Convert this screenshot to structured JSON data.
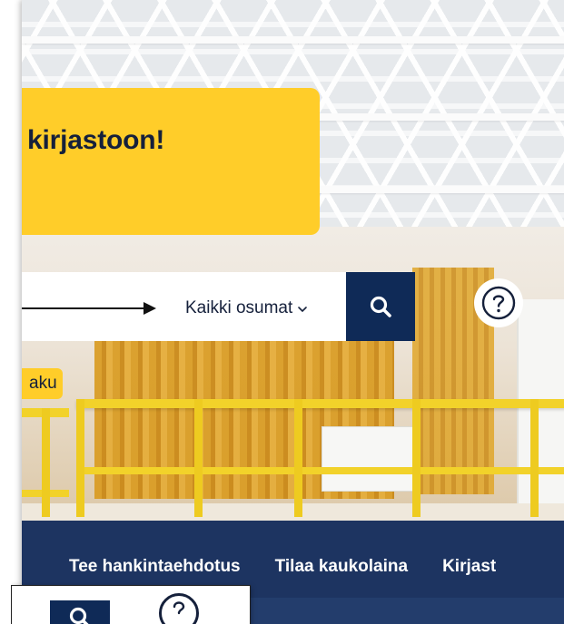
{
  "hero": {
    "title": "kirjastoon!"
  },
  "search": {
    "filter_label": "Kaikki osumat",
    "search_icon": "search-icon",
    "help_icon": "help-circle-icon"
  },
  "tag": {
    "label": "aku"
  },
  "nav": {
    "items": [
      {
        "label": "Tee hankintaehdotus"
      },
      {
        "label": "Tilaa kaukolaina"
      },
      {
        "label": "Kirjast"
      }
    ]
  },
  "colors": {
    "accent_yellow": "#ffcd29",
    "navy": "#0f2a57",
    "nav_bg": "#1d3461",
    "text_dark": "#15203b"
  }
}
